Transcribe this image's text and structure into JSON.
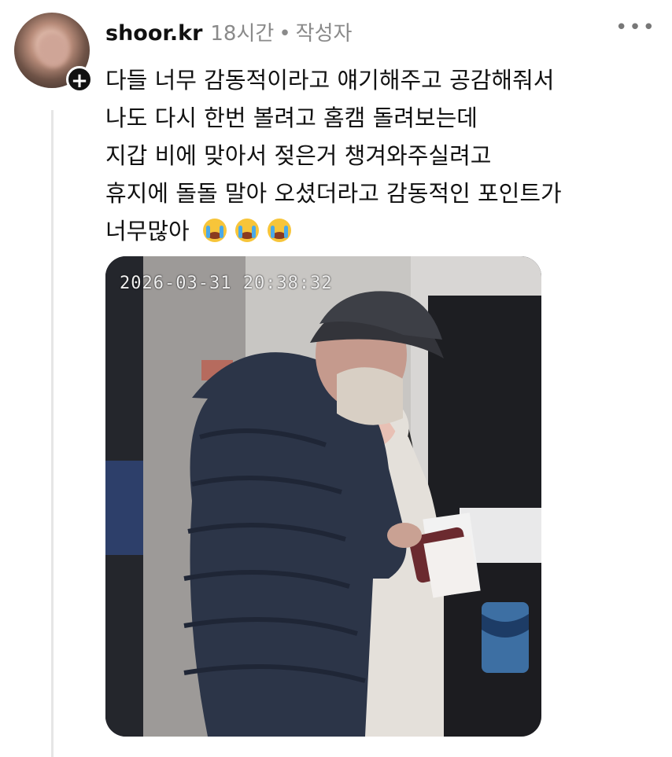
{
  "post": {
    "username": "shoor.kr",
    "time": "18시간",
    "separator": "•",
    "author_label": "작성자",
    "more_icon": "more-horizontal-icon",
    "follow_icon": "plus-icon",
    "text_lines": [
      "다들 너무 감동적이라고 얘기해주고 공감해줘서",
      "나도 다시 한번 볼려고 홈캠 돌려보는데",
      "지갑 비에 맞아서 젖은거 챙겨와주실려고",
      "휴지에 돌돌 말아 오셨더라고 감동적인 포인트가",
      "너무많아"
    ],
    "emoji": [
      "loudly-crying-face",
      "loudly-crying-face",
      "loudly-crying-face"
    ]
  },
  "media": {
    "type": "home-camera-still",
    "timestamp": "2026-03-31  20:38:32"
  }
}
